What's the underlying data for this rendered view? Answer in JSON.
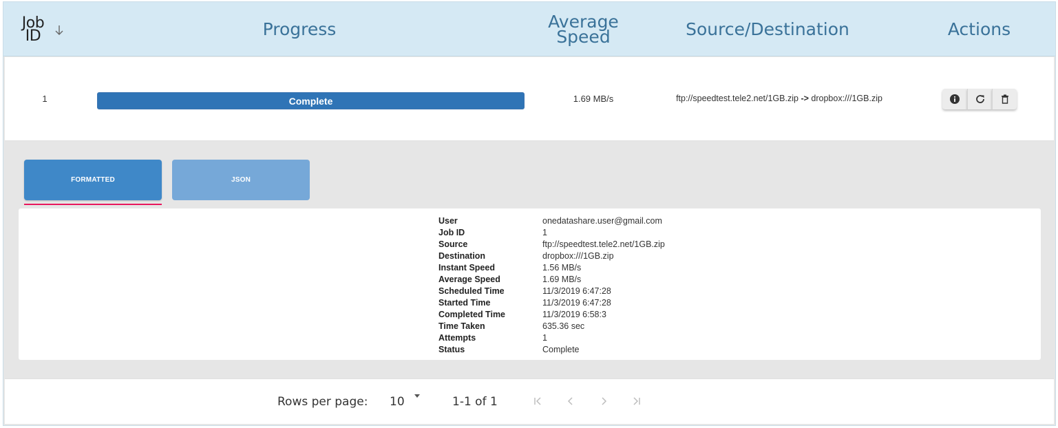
{
  "header": {
    "job_id": "Job ID",
    "progress": "Progress",
    "average_speed": "Average Speed",
    "source_destination": "Source/Destination",
    "actions": "Actions"
  },
  "job": {
    "id": "1",
    "progress_label": "Complete",
    "progress_percent": 100,
    "average_speed": "1.69 MB/s",
    "source": "ftp://speedtest.tele2.net/1GB.zip",
    "arrow": "->",
    "destination": "dropbox:///1GB.zip",
    "actions": [
      "info-icon",
      "refresh-icon",
      "delete-icon"
    ]
  },
  "tabs": {
    "formatted": "FORMATTED",
    "json": "JSON",
    "active": "formatted"
  },
  "details": [
    {
      "label": "User",
      "value": "onedatashare.user@gmail.com"
    },
    {
      "label": "Job ID",
      "value": "1"
    },
    {
      "label": "Source",
      "value": "ftp://speedtest.tele2.net/1GB.zip"
    },
    {
      "label": "Destination",
      "value": "dropbox:///1GB.zip"
    },
    {
      "label": "Instant Speed",
      "value": "1.56 MB/s"
    },
    {
      "label": "Average Speed",
      "value": "1.69 MB/s"
    },
    {
      "label": "Scheduled Time",
      "value": "11/3/2019 6:47:28"
    },
    {
      "label": "Started Time",
      "value": "11/3/2019 6:47:28"
    },
    {
      "label": "Completed Time",
      "value": "11/3/2019 6:58:3"
    },
    {
      "label": "Time Taken",
      "value": "635.36 sec"
    },
    {
      "label": "Attempts",
      "value": "1"
    },
    {
      "label": "Status",
      "value": "Complete"
    }
  ],
  "footer": {
    "rows_per_page_label": "Rows per page:",
    "rows_per_page_value": "10",
    "page_range": "1-1 of 1"
  },
  "colors": {
    "header_bg": "#d5e9f4",
    "header_text": "#3a7299",
    "progress": "#2f74b6",
    "tab_active": "#3f88c8",
    "tab_inactive": "#76a8d8",
    "tab_indicator": "#e8175d"
  }
}
